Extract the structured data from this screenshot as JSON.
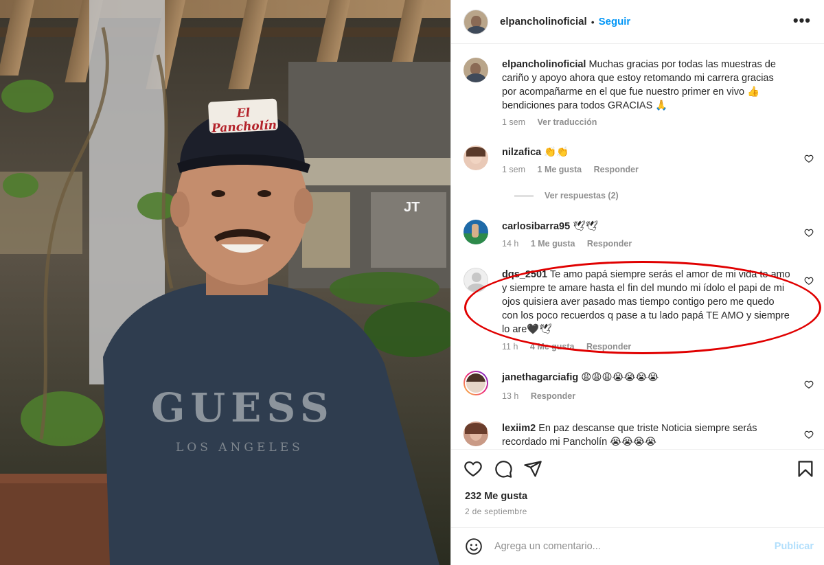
{
  "post": {
    "author": "elpancholinoficial",
    "separator": "•",
    "follow_label": "Seguir",
    "more_label": "•••",
    "photo": {
      "cap_text": "El Pancholín",
      "shirt_text": "GUESS",
      "shirt_subtext": "LOS ANGELES"
    }
  },
  "caption": {
    "username": "elpancholinoficial",
    "text": "Muchas gracias por todas las muestras de cariño y apoyo ahora que estoy retomando mi carrera gracias por acompañarme en el que fue nuestro primer en vivo 👍 bendiciones para todos GRACIAS 🙏",
    "time": "1 sem",
    "translate_label": "Ver traducción"
  },
  "comments": [
    {
      "username": "nilzafica",
      "text": "👏👏",
      "time": "1 sem",
      "likes": "1 Me gusta",
      "reply_label": "Responder",
      "view_replies": "Ver respuestas (2)"
    },
    {
      "username": "carlosibarra95",
      "text": "🕊🕊",
      "time": "14 h",
      "likes": "1 Me gusta",
      "reply_label": "Responder"
    },
    {
      "username": "dqs_2501",
      "text": "Te amo papá siempre serás el amor de mi vida te amo y siempre te amare hasta el fin del mundo mi ídolo el papi de mi ojos quisiera aver pasado mas tiempo contigo pero me quedo con los poco recuerdos q pase a tu lado papá TE AMO y siempre lo are🖤🕊",
      "time": "11 h",
      "likes": "4 Me gusta",
      "reply_label": "Responder"
    },
    {
      "username": "janethagarciafig",
      "text": "😩😩😩😭😭😭😭",
      "time": "13 h",
      "reply_label": "Responder"
    },
    {
      "username": "lexiim2",
      "text": "En paz descanse que triste Noticia siempre serás recordado mi Pancholín 😭😭😭😭"
    }
  ],
  "actions": {
    "like_icon": "heart-icon",
    "comment_icon": "comment-icon",
    "share_icon": "paper-plane-icon",
    "save_icon": "bookmark-icon",
    "likes_count": "232 Me gusta",
    "date": "2 de septiembre"
  },
  "add_comment": {
    "placeholder": "Agrega un comentario...",
    "publish_label": "Publicar",
    "emoji_icon": "emoji-smile-icon"
  },
  "colors": {
    "link_blue": "#0095f6",
    "publish_disabled": "#b2dffc",
    "meta_gray": "#8e8e8e",
    "highlight_ring": "#e00000"
  }
}
